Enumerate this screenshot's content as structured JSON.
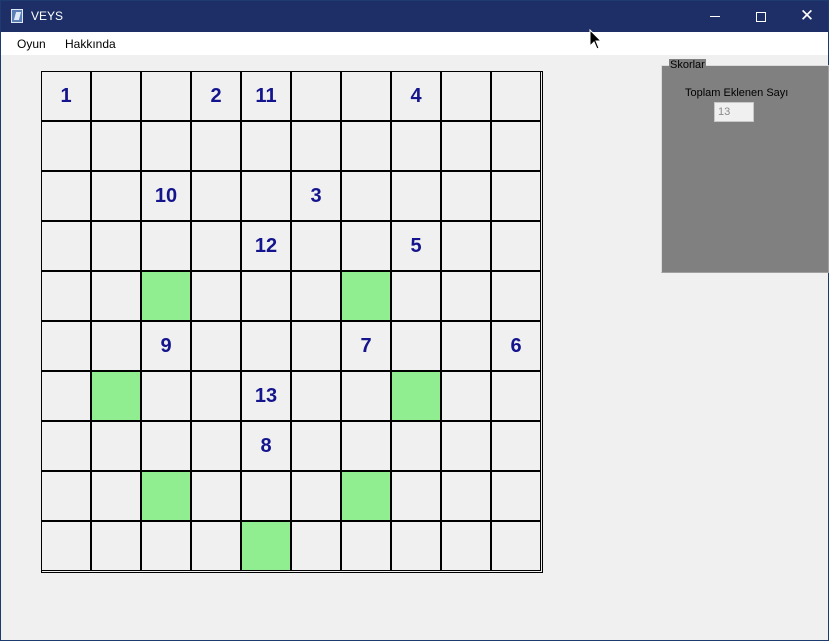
{
  "window": {
    "title": "VEYS"
  },
  "titlebar_icons": {
    "app": "app-icon",
    "minimize": "minimize-icon",
    "maximize": "maximize-icon",
    "close": "close-icon"
  },
  "menu": {
    "items": [
      "Oyun",
      "Hakkında"
    ]
  },
  "board": {
    "rows": 10,
    "cols": 10,
    "cells": [
      [
        "1",
        "",
        "",
        "2",
        "11",
        "",
        "",
        "4",
        "",
        ""
      ],
      [
        "",
        "",
        "",
        "",
        "",
        "",
        "",
        "",
        "",
        ""
      ],
      [
        "",
        "",
        "10",
        "",
        "",
        "3",
        "",
        "",
        "",
        ""
      ],
      [
        "",
        "",
        "",
        "",
        "12",
        "",
        "",
        "5",
        "",
        ""
      ],
      [
        "",
        "",
        "",
        "",
        "",
        "",
        "",
        "",
        "",
        ""
      ],
      [
        "",
        "",
        "9",
        "",
        "",
        "",
        "7",
        "",
        "",
        "6"
      ],
      [
        "",
        "",
        "",
        "",
        "13",
        "",
        "",
        "",
        "",
        ""
      ],
      [
        "",
        "",
        "",
        "",
        "8",
        "",
        "",
        "",
        "",
        ""
      ],
      [
        "",
        "",
        "",
        "",
        "",
        "",
        "",
        "",
        "",
        ""
      ],
      [
        "",
        "",
        "",
        "",
        "",
        "",
        "",
        "",
        "",
        ""
      ]
    ],
    "highlighted": [
      [
        4,
        2
      ],
      [
        4,
        6
      ],
      [
        6,
        1
      ],
      [
        6,
        7
      ],
      [
        8,
        2
      ],
      [
        8,
        6
      ],
      [
        9,
        4
      ]
    ],
    "highlight_color": "#90ee90",
    "number_color": "#14148c"
  },
  "scores": {
    "group_title": "Skorlar",
    "total_label": "Toplam Eklenen Sayı",
    "total_value": "13"
  }
}
